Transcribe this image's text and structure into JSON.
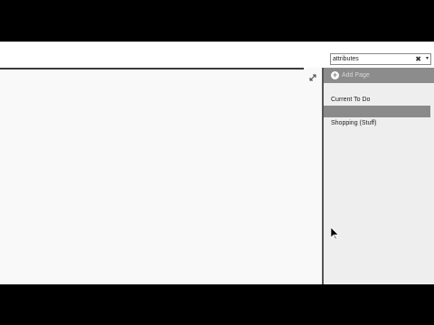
{
  "search": {
    "value": "attributes",
    "clear_glyph": "✖",
    "dropdown_glyph": "▾"
  },
  "pages_panel": {
    "add_page_label": "Add Page",
    "items": [
      {
        "label": "Current To Do",
        "selected": false
      },
      {
        "label": "",
        "selected": true
      },
      {
        "label": "Shopping (Stuff)",
        "selected": false
      }
    ]
  },
  "icons": {
    "expand": "expand-icon",
    "add": "plus-circle-icon",
    "cursor": "mouse-pointer-icon"
  },
  "colors": {
    "pane_background": "#eeeeee",
    "add_page_bar": "#8c8c8c",
    "selected_item": "#8a8a8a",
    "page_background": "#f9f9f9"
  }
}
